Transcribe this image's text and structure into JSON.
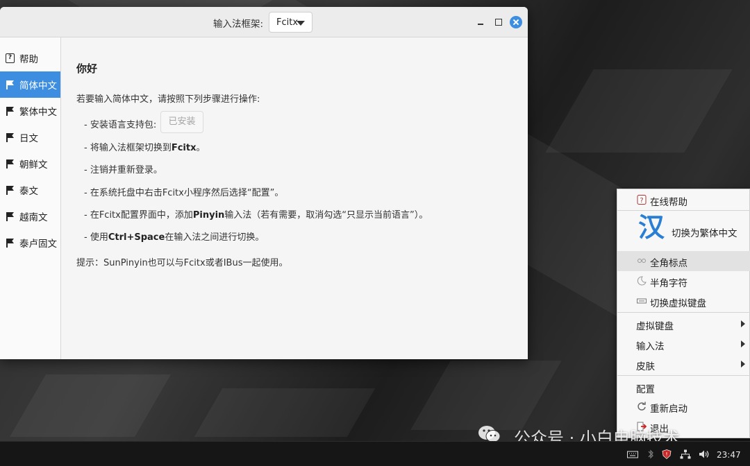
{
  "window": {
    "framework_label": "输入法框架:",
    "framework_value": "Fcitx"
  },
  "sidebar": {
    "items": [
      {
        "label": "帮助"
      },
      {
        "label": "简体中文"
      },
      {
        "label": "繁体中文"
      },
      {
        "label": "日文"
      },
      {
        "label": "朝鲜文"
      },
      {
        "label": "泰文"
      },
      {
        "label": "越南文"
      },
      {
        "label": "泰卢固文"
      }
    ]
  },
  "content": {
    "title": "你好",
    "intro": "若要输入简体中文，请按照下列步骤进行操作:",
    "step1": "- 安装语言支持包:",
    "installed_button": "已安装",
    "step2_a": "- 将输入法框架切换到",
    "step2_b": "Fcitx",
    "step2_c": "。",
    "step3": "- 注销并重新登录。",
    "step4": "- 在系统托盘中右击Fcitx小程序然后选择“配置”。",
    "step5_a": "- 在Fcitx配置界面中，添加",
    "step5_b": "Pinyin",
    "step5_c": "输入法（若有需要，取消勾选“只显示当前语言”）。",
    "step6_a": "- 使用",
    "step6_b": "Ctrl+Space",
    "step6_c": "在输入法之间进行切换。",
    "tip": "提示：SunPinyin也可以与Fcitx或者IBus一起使用。"
  },
  "menu": {
    "online_help": "在线帮助",
    "big_glyph": "汉",
    "switch_trad": "切换为繁体中文",
    "full_punct": "全角标点",
    "half_char": "半角字符",
    "virtual_kb_toggle": "切换虚拟键盘",
    "virtual_kb": "虚拟键盘",
    "input_method": "输入法",
    "skin": "皮肤",
    "config": "配置",
    "restart": "重新启动",
    "quit": "退出"
  },
  "taskbar": {
    "clock": "23:47"
  },
  "watermark": "公众号 · 小白电脑技术"
}
